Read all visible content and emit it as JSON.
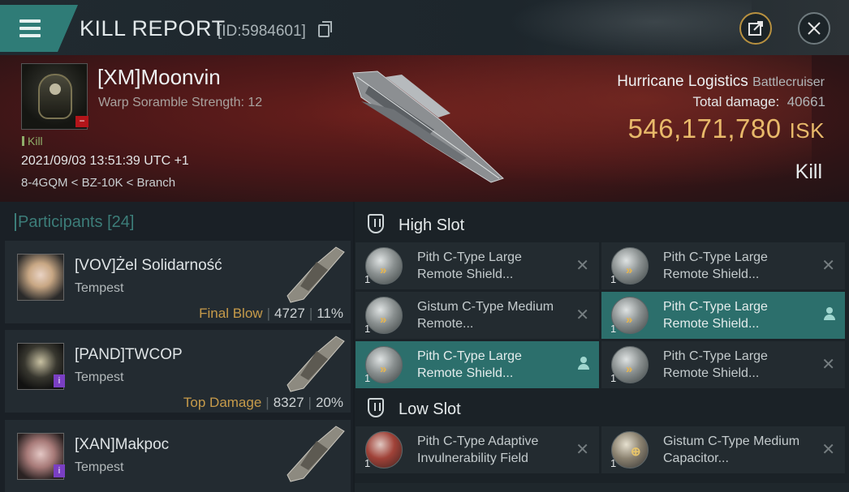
{
  "header": {
    "title": "KILL REPORT",
    "id": "[ID:5984601]",
    "share_icon": "share-icon",
    "close_icon": "close-icon"
  },
  "victim": {
    "name": "[XM]Moonvin",
    "scramble": "Warp Soramble Strength: 12",
    "tag": "Kill",
    "datetime": "2021/09/03 13:51:39 UTC +1",
    "location": "8-4GQM < BZ-10K < Branch",
    "badge": "−"
  },
  "ship": {
    "name": "Hurricane Logistics",
    "class": "Battlecruiser",
    "total_damage_label": "Total damage:",
    "total_damage": "40661",
    "isk_value": "546,171,780",
    "isk_unit": "ISK",
    "result": "Kill"
  },
  "participants": {
    "label": "Participants",
    "count": "[24]",
    "rows": [
      {
        "name": "[VOV]Żel Solidarność",
        "ship": "Tempest",
        "stat_label": "Final Blow",
        "damage": "4727",
        "pct": "11%"
      },
      {
        "name": "[PAND]TWCOP",
        "ship": "Tempest",
        "stat_label": "Top Damage",
        "damage": "8327",
        "pct": "20%"
      },
      {
        "name": "[XAN]Makpoc",
        "ship": "Tempest",
        "stat_label": "",
        "damage": "",
        "pct": ""
      }
    ]
  },
  "slots": {
    "high": {
      "label": "High Slot",
      "modules": [
        {
          "name": "Pith C-Type Large Remote Shield...",
          "qty": "1"
        },
        {
          "name": "Pith C-Type Large Remote Shield...",
          "qty": "1"
        },
        {
          "name": "Gistum C-Type Medium Remote...",
          "qty": "1"
        },
        {
          "name": "Pith C-Type Large Remote Shield...",
          "qty": "1"
        },
        {
          "name": "Pith C-Type Large Remote Shield...",
          "qty": "1"
        },
        {
          "name": "Pith C-Type Large Remote Shield...",
          "qty": "1"
        }
      ]
    },
    "low": {
      "label": "Low Slot",
      "modules": [
        {
          "name": "Pith C-Type Adaptive Invulnerability Field",
          "qty": "1"
        },
        {
          "name": "Gistum C-Type Medium Capacitor...",
          "qty": "1"
        }
      ]
    }
  },
  "colors": {
    "accent": "#2f7c77",
    "isk": "#e8b96a",
    "stat_label": "#c79b4a",
    "selected_module": "#2c6f6c"
  }
}
